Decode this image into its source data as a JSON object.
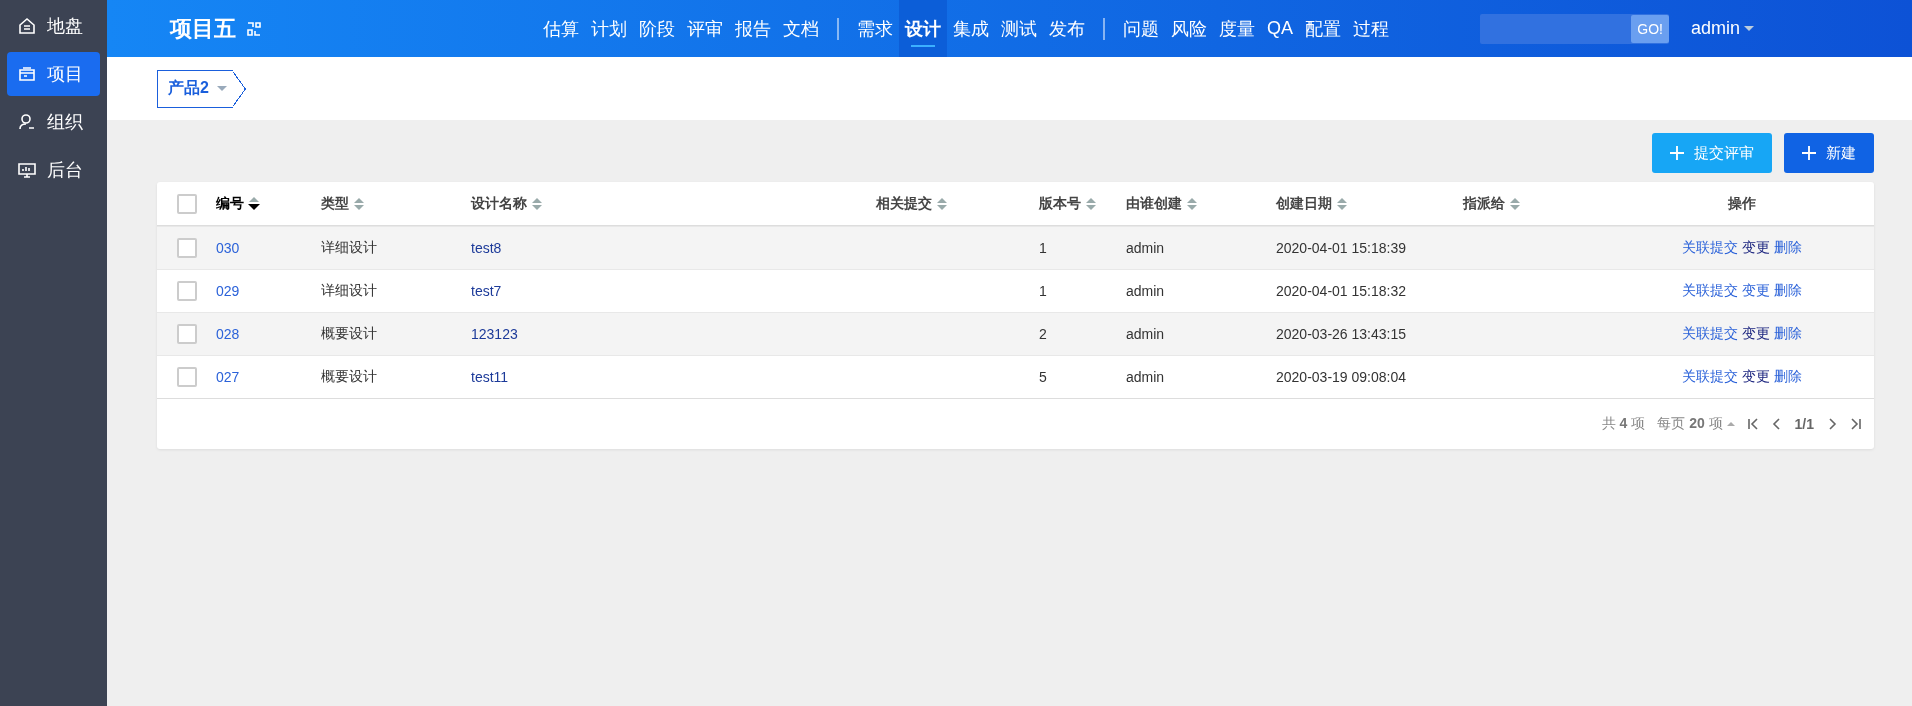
{
  "sidebar": {
    "items": [
      {
        "label": "地盘",
        "selected": false
      },
      {
        "label": "项目",
        "selected": true
      },
      {
        "label": "组织",
        "selected": false
      },
      {
        "label": "后台",
        "selected": false
      }
    ]
  },
  "header": {
    "project_title": "项目五",
    "nav_groups": [
      [
        {
          "label": "估算",
          "selected": false
        },
        {
          "label": "计划",
          "selected": false
        },
        {
          "label": "阶段",
          "selected": false
        },
        {
          "label": "评审",
          "selected": false
        },
        {
          "label": "报告",
          "selected": false
        },
        {
          "label": "文档",
          "selected": false
        }
      ],
      [
        {
          "label": "需求",
          "selected": false
        },
        {
          "label": "设计",
          "selected": true
        },
        {
          "label": "集成",
          "selected": false
        },
        {
          "label": "测试",
          "selected": false
        },
        {
          "label": "发布",
          "selected": false
        }
      ],
      [
        {
          "label": "问题",
          "selected": false
        },
        {
          "label": "风险",
          "selected": false
        },
        {
          "label": "度量",
          "selected": false
        },
        {
          "label": "QA",
          "selected": false
        },
        {
          "label": "配置",
          "selected": false
        },
        {
          "label": "过程",
          "selected": false
        }
      ]
    ],
    "search_button": "GO!",
    "user": "admin"
  },
  "breadcrumb": {
    "product": "产品2"
  },
  "actions": [
    {
      "label": "提交评审",
      "kind": "secondary"
    },
    {
      "label": "新建",
      "kind": "primary"
    }
  ],
  "table": {
    "select_all_checked": false,
    "columns": [
      {
        "label": "编号",
        "sortable": true,
        "sorted": true
      },
      {
        "label": "类型",
        "sortable": true,
        "sorted": false
      },
      {
        "label": "设计名称",
        "sortable": true,
        "sorted": false
      },
      {
        "label": "相关提交",
        "sortable": true,
        "sorted": false
      },
      {
        "label": "版本号",
        "sortable": true,
        "sorted": false
      },
      {
        "label": "由谁创建",
        "sortable": true,
        "sorted": false
      },
      {
        "label": "创建日期",
        "sortable": true,
        "sorted": false
      },
      {
        "label": "指派给",
        "sortable": true,
        "sorted": false
      },
      {
        "label": "操作"
      }
    ],
    "rows": [
      {
        "checked": false,
        "id": "030",
        "type": "详细设计",
        "name": "test8",
        "version": "1",
        "creator": "admin",
        "date": "2020-04-01 15:18:39",
        "actions": [
          {
            "label": "关联提交",
            "visited": false
          },
          {
            "label": "变更",
            "visited": true
          },
          {
            "label": "删除",
            "visited": false
          }
        ]
      },
      {
        "checked": false,
        "id": "029",
        "type": "详细设计",
        "name": "test7",
        "version": "1",
        "creator": "admin",
        "date": "2020-04-01 15:18:32",
        "actions": [
          {
            "label": "关联提交",
            "visited": false
          },
          {
            "label": "变更",
            "visited": false
          },
          {
            "label": "删除",
            "visited": false
          }
        ]
      },
      {
        "checked": false,
        "id": "028",
        "type": "概要设计",
        "name": "123123",
        "version": "2",
        "creator": "admin",
        "date": "2020-03-26 13:43:15",
        "actions": [
          {
            "label": "关联提交",
            "visited": false
          },
          {
            "label": "变更",
            "visited": true
          },
          {
            "label": "删除",
            "visited": false
          }
        ]
      },
      {
        "checked": false,
        "id": "027",
        "type": "概要设计",
        "name": "test11",
        "version": "5",
        "creator": "admin",
        "date": "2020-03-19 09:08:04",
        "actions": [
          {
            "label": "关联提交",
            "visited": false
          },
          {
            "label": "变更",
            "visited": true
          },
          {
            "label": "删除",
            "visited": false
          }
        ]
      }
    ]
  },
  "pager": {
    "total_prefix": "共",
    "total": "4",
    "total_suffix": "项",
    "per_page_prefix": "每页",
    "per_page": "20",
    "per_page_suffix": "项",
    "page": "1/1"
  }
}
